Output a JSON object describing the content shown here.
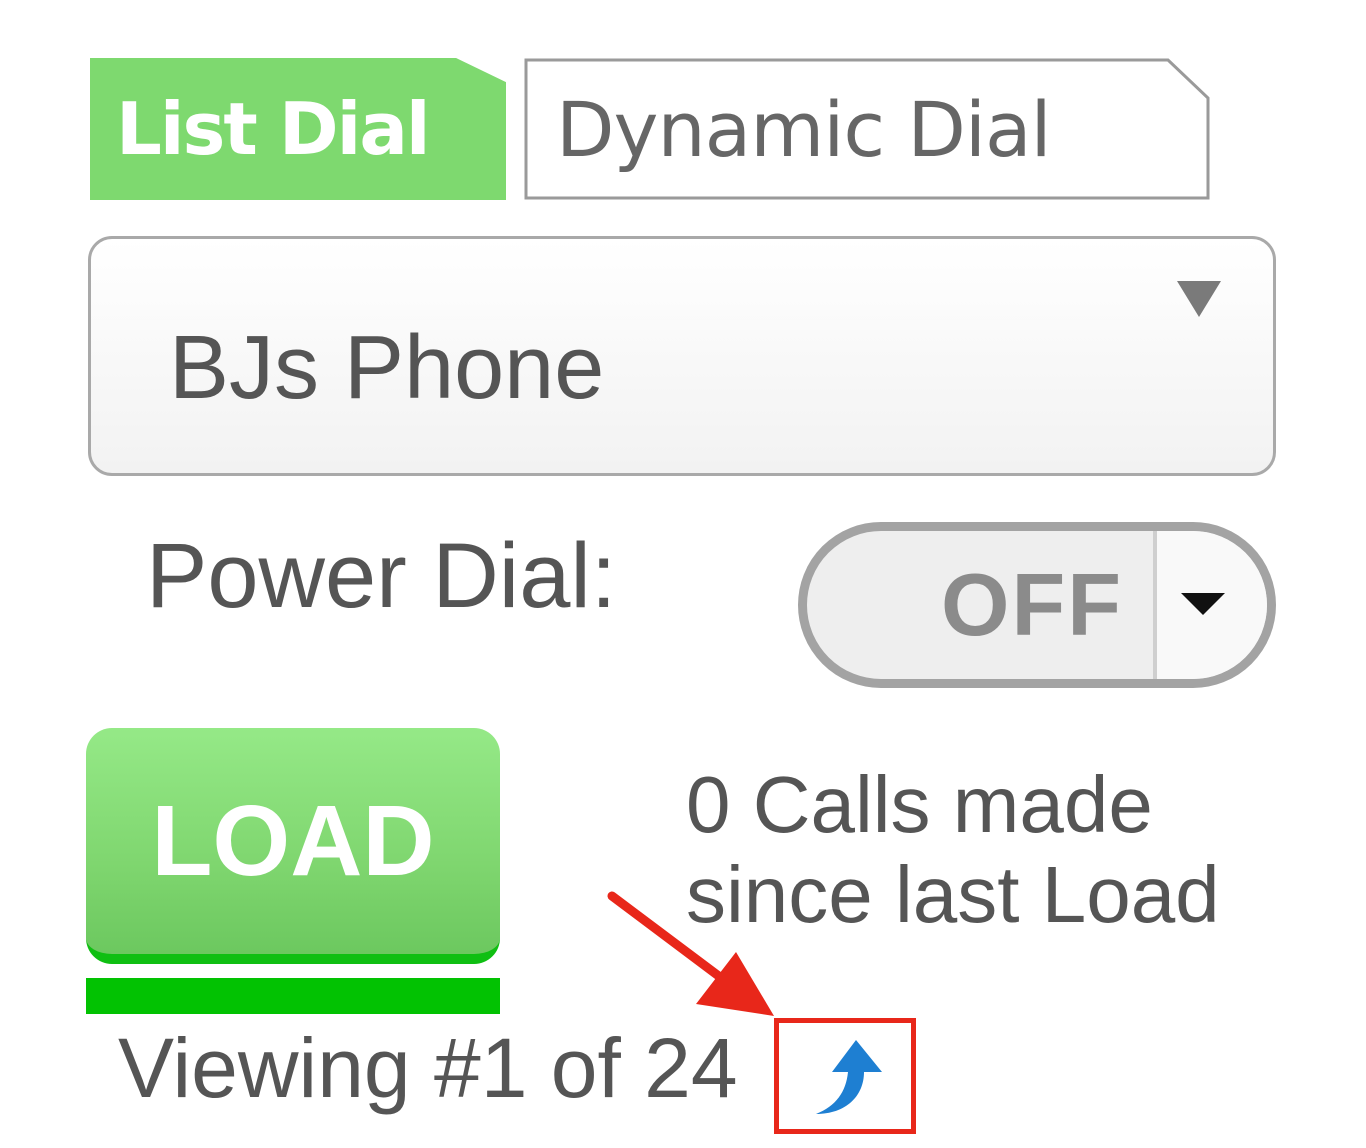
{
  "tabs": [
    {
      "label": "List Dial",
      "active": true
    },
    {
      "label": "Dynamic Dial",
      "active": false
    }
  ],
  "list_select": {
    "selected": "BJs Phone"
  },
  "power_dial": {
    "label": "Power Dial:",
    "state": "OFF"
  },
  "load_button": {
    "label": "LOAD"
  },
  "calls_status": {
    "line1": "0 Calls made",
    "line2": "since last Load"
  },
  "viewing": {
    "text": "Viewing #1 of 24"
  },
  "icons": {
    "up": "curved-up-arrow-icon",
    "annotation": "red-arrow-icon"
  },
  "colors": {
    "accent_green": "#7ed96f",
    "bar_green": "#02c202",
    "annotation_red": "#e8271a",
    "icon_blue": "#1e7fd2"
  }
}
